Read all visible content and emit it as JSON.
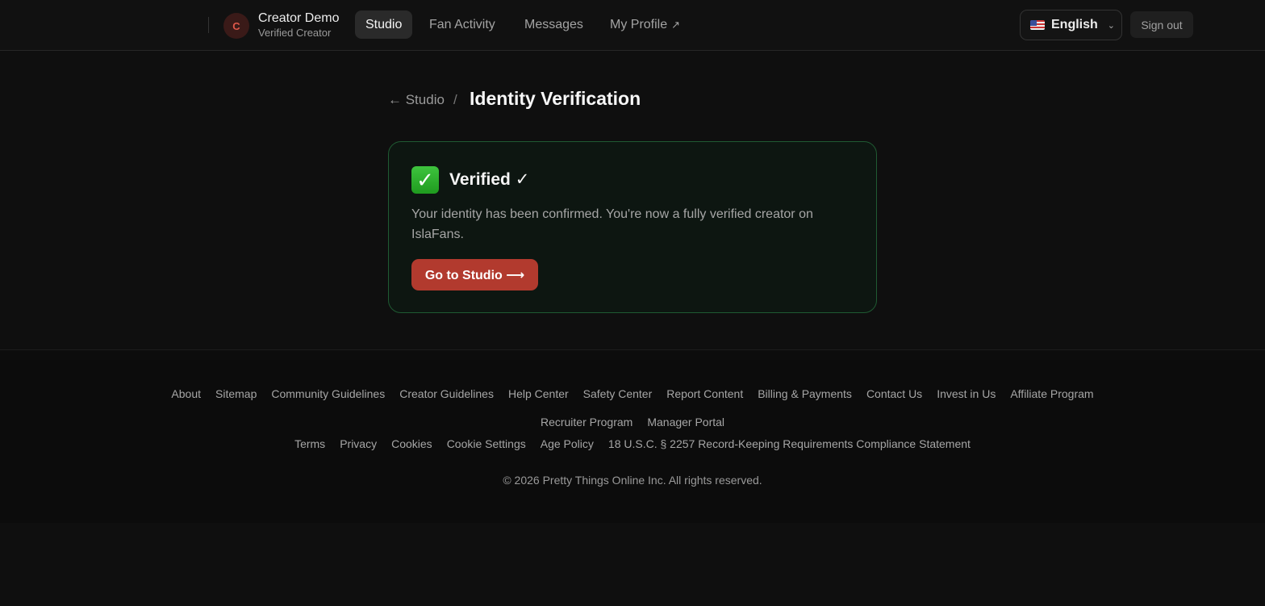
{
  "header": {
    "avatar_letter": "C",
    "creator_name": "Creator Demo",
    "creator_status": "Verified Creator",
    "nav": [
      {
        "label": "Studio",
        "active": true
      },
      {
        "label": "Fan Activity",
        "active": false
      },
      {
        "label": "Messages",
        "active": false
      },
      {
        "label": "My Profile",
        "active": false,
        "external_icon": "↗"
      }
    ],
    "language": {
      "flag_icon": "us-flag-icon",
      "label": "English",
      "chevron": "⌄"
    },
    "sign_out": "Sign out"
  },
  "breadcrumb": {
    "back_label": "← Studio",
    "separator": "/",
    "title": "Identity Verification"
  },
  "card": {
    "icon": "✓",
    "title": "Verified ✓",
    "description": "Your identity has been confirmed. You're now a fully verified creator on IslaFans.",
    "button_label": "Go to Studio ⟶",
    "accent_color": "#b23a2e",
    "border_color": "#1f5a32"
  },
  "footer": {
    "links_row1": [
      "About",
      "Sitemap",
      "Community Guidelines",
      "Creator Guidelines",
      "Help Center",
      "Safety Center",
      "Report Content",
      "Billing & Payments",
      "Contact Us",
      "Invest in Us",
      "Affiliate Program"
    ],
    "links_row2": [
      "Recruiter Program",
      "Manager Portal"
    ],
    "links_row3": [
      "Terms",
      "Privacy",
      "Cookies",
      "Cookie Settings",
      "Age Policy",
      "18 U.S.C. § 2257 Record-Keeping Requirements Compliance Statement"
    ],
    "copyright": "© 2026 Pretty Things Online Inc. All rights reserved."
  }
}
